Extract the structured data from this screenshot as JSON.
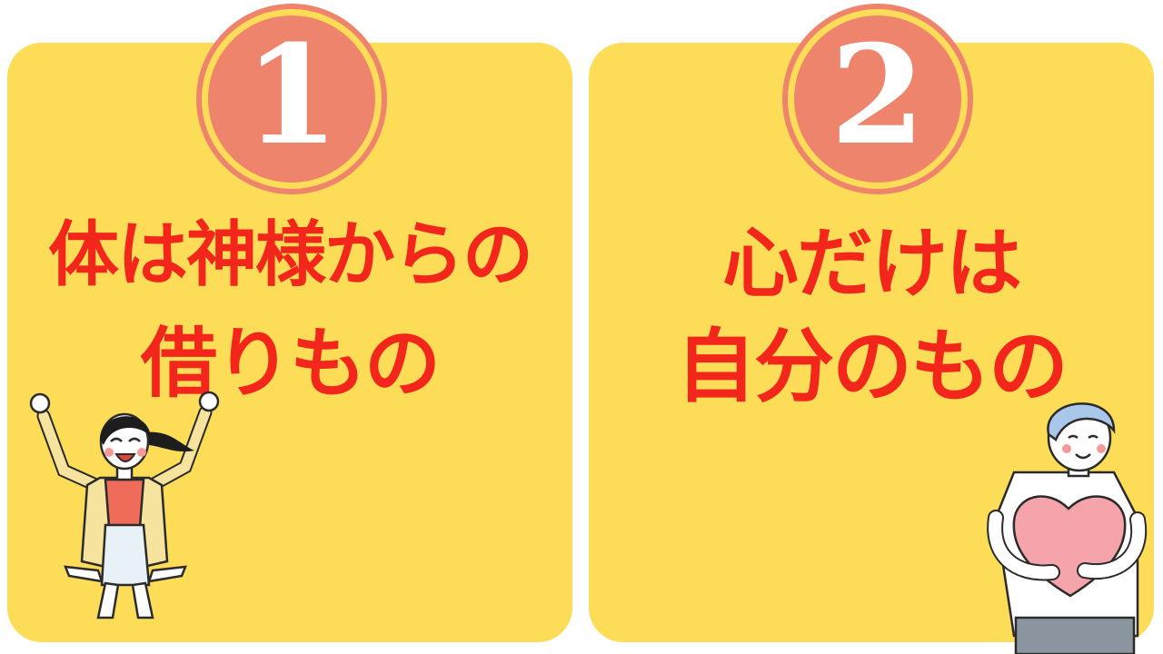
{
  "colors": {
    "background": "#ffffff",
    "card": "#fddc58",
    "badge_fill": "#ef846c",
    "badge_ring": "#ef846c",
    "badge_gap": "#fddc58",
    "number": "#ffffff",
    "title": "#f3261c"
  },
  "cards": [
    {
      "number": "1",
      "title_line1": "体は神様からの",
      "title_line2": "借りもの",
      "illustration": "cheering-woman-illustration"
    },
    {
      "number": "2",
      "title_line1": "心だけは",
      "title_line2": "自分のもの",
      "illustration": "man-hugging-heart-illustration"
    }
  ]
}
